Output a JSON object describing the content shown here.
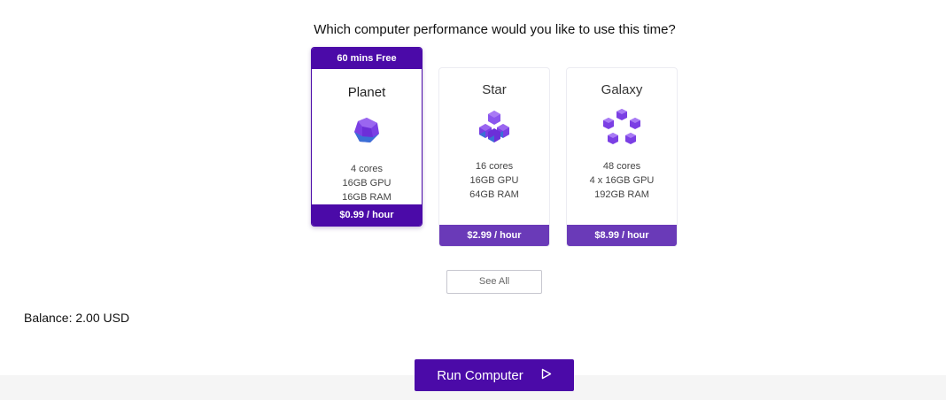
{
  "question": "Which computer performance would you like to use this time?",
  "cards": [
    {
      "badge": "60 mins Free",
      "name": "Planet",
      "icon": "planet-gem-icon",
      "cores": "4 cores",
      "gpu": "16GB GPU",
      "ram": "16GB RAM",
      "price": "$0.99 / hour",
      "selected": true
    },
    {
      "name": "Star",
      "icon": "star-gem-cluster-icon",
      "cores": "16 cores",
      "gpu": "16GB GPU",
      "ram": "64GB RAM",
      "price": "$2.99 / hour",
      "selected": false
    },
    {
      "name": "Galaxy",
      "icon": "galaxy-gem-ring-icon",
      "cores": "48 cores",
      "gpu": "4 x 16GB GPU",
      "ram": "192GB RAM",
      "price": "$8.99 / hour",
      "selected": false
    }
  ],
  "see_all_label": "See All",
  "balance": "Balance: 2.00 USD",
  "run_button": {
    "label": "Run Computer",
    "icon": "play-outline-icon"
  },
  "colors": {
    "primary": "#4b0aa8",
    "secondary": "#6a3ab8",
    "gem": "#7b3fe4"
  }
}
